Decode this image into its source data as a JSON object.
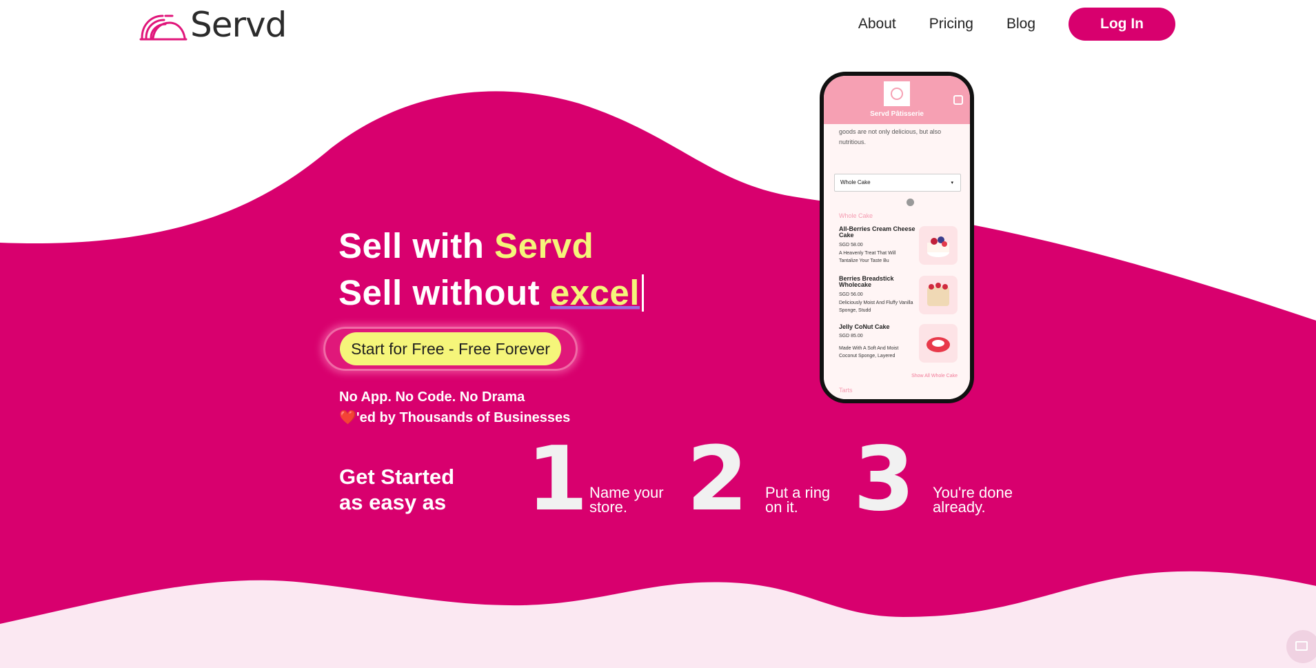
{
  "brand": {
    "name": "Servd",
    "accent": "#d8006e",
    "highlight": "#f5f57a",
    "light_bg": "#fbe8f2"
  },
  "nav": {
    "items": [
      "About",
      "Pricing",
      "Blog"
    ],
    "login_label": "Log In"
  },
  "hero": {
    "line1_prefix": "Sell with ",
    "line1_highlight": "Servd",
    "line2_prefix": "Sell without ",
    "line2_typed": "excel",
    "cta_label": "Start for Free - Free Forever",
    "tagline1": "No App. No Code. No Drama",
    "tagline2_heart": "❤️",
    "tagline2_text": "'ed by Thousands of Businesses"
  },
  "steps": {
    "heading_line1": "Get Started",
    "heading_line2": "as easy as",
    "items": [
      {
        "number": "1",
        "line1": "Name your",
        "line2": "store."
      },
      {
        "number": "2",
        "line1": "Put a ring",
        "line2": "on it."
      },
      {
        "number": "3",
        "line1": "You're done",
        "line2": "already."
      }
    ]
  },
  "phone": {
    "store_name": "Servd Pâtisserie",
    "intro_text": "goods are not only delicious, but also nutritious.",
    "select_value": "Whole Cake",
    "category": "Whole Cake",
    "items": [
      {
        "name": "All-Berries Cream Cheese Cake",
        "price": "SGD 58.00",
        "desc": "A Heavenly Treat That Will Tantalize Your Taste Bu"
      },
      {
        "name": "Berries Breadstick Wholecake",
        "price": "SGD 56.00",
        "desc": "Deliciously Moist And Fluffy Vanilla Sponge, Studd"
      },
      {
        "name": "Jelly CoNut Cake",
        "price": "SGD 85.00",
        "desc": "Made With A Soft And Moist Coconut Sponge, Layered"
      }
    ],
    "show_all": "Show All Whole Cake",
    "next_category": "Tarts"
  },
  "icons": {
    "logo": "cloche-icon",
    "feedback": "chat-icon",
    "cart": "bag-icon"
  }
}
